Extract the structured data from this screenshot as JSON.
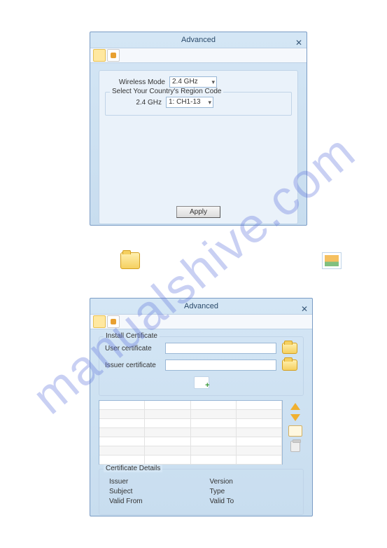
{
  "watermark": "manualshive.com",
  "window1": {
    "title": "Advanced",
    "wirelessModeLabel": "Wireless Mode",
    "wirelessModeValue": "2.4 GHz",
    "regionLegend": "Select Your Country's Region Code",
    "band24Label": "2.4 GHz",
    "band24Value": "1: CH1-13",
    "applyLabel": "Apply"
  },
  "window2": {
    "title": "Advanced",
    "installLegend": "Install Certificate",
    "userCertLabel": "User certificate",
    "issuerCertLabel": "Issuer certificate",
    "detailsLegend": "Certificate Details",
    "left": {
      "issuer": "Issuer",
      "subject": "Subject",
      "validFrom": "Valid From"
    },
    "right": {
      "version": "Version",
      "type": "Type",
      "validTo": "Valid To"
    }
  }
}
